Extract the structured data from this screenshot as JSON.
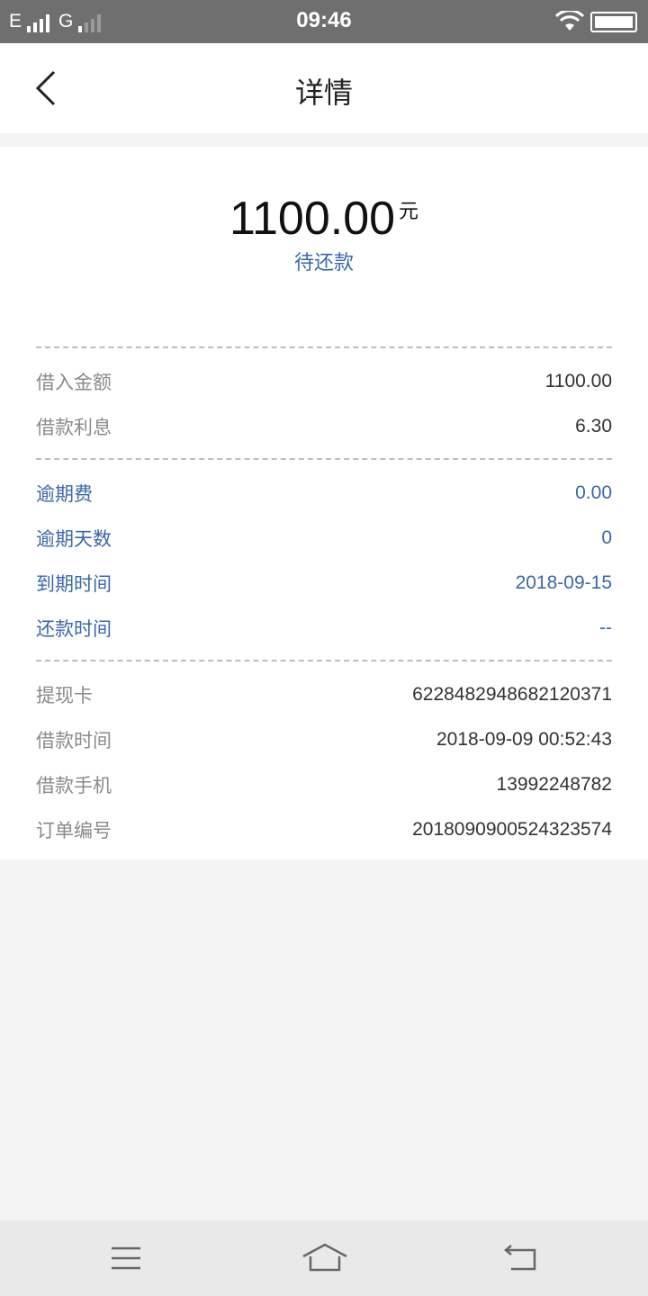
{
  "status_bar": {
    "network_1": "E",
    "network_2": "G",
    "time": "09:46"
  },
  "header": {
    "title": "详情"
  },
  "summary": {
    "amount": "1100.00",
    "unit": "元",
    "status": "待还款"
  },
  "loan": [
    {
      "label": "借入金额",
      "value": "1100.00"
    },
    {
      "label": "借款利息",
      "value": "6.30"
    }
  ],
  "overdue": [
    {
      "label": "逾期费",
      "value": "0.00"
    },
    {
      "label": "逾期天数",
      "value": "0"
    },
    {
      "label": "到期时间",
      "value": "2018-09-15"
    },
    {
      "label": "还款时间",
      "value": "--"
    }
  ],
  "info": [
    {
      "label": "提现卡",
      "value": "6228482948682120371"
    },
    {
      "label": "借款时间",
      "value": "2018-09-09 00:52:43"
    },
    {
      "label": "借款手机",
      "value": "13992248782"
    },
    {
      "label": "订单编号",
      "value": "2018090900524323574"
    }
  ],
  "colors": {
    "accent": "#3b68a8",
    "status_bar": "#6f6f6f"
  },
  "icons": {
    "back": "chevron-left-icon",
    "menu": "menu-icon",
    "home": "home-icon",
    "return": "return-icon"
  }
}
